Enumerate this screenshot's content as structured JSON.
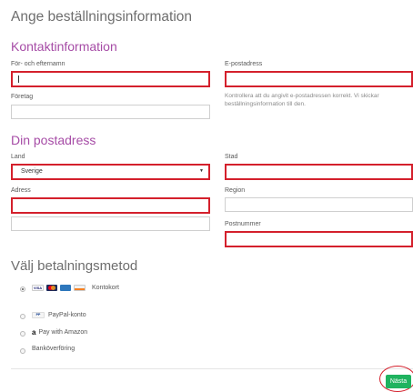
{
  "page": {
    "title": "Ange beställningsinformation"
  },
  "contact": {
    "heading": "Kontaktinformation",
    "name_label": "För- och efternamn",
    "name_value": "",
    "company_label": "Företag",
    "company_value": "",
    "email_label": "E-postadress",
    "email_value": "",
    "email_help_1": "Kontrollera att du angivit e-postadressen korrekt. Vi skickar",
    "email_help_2": "beställningsinformation till den."
  },
  "address": {
    "heading": "Din postadress",
    "country_label": "Land",
    "country_value": "Sverige",
    "address_label": "Adress",
    "address_value": "",
    "address2_value": "",
    "city_label": "Stad",
    "city_value": "",
    "region_label": "Region",
    "region_value": "",
    "postcode_label": "Postnummer",
    "postcode_value": ""
  },
  "payment": {
    "heading": "Välj betalningsmetod",
    "options": [
      {
        "label": "Kontokort",
        "selected": true,
        "icons": [
          "visa-icon",
          "mastercard-icon",
          "amex-icon",
          "discover-icon"
        ]
      },
      {
        "label": "PayPal-konto",
        "selected": false,
        "icons": [
          "paypal-icon"
        ]
      },
      {
        "label": "Pay with Amazon",
        "selected": false,
        "icons": [
          "amazon-icon"
        ]
      },
      {
        "label": "Banköverföring",
        "selected": false,
        "icons": []
      }
    ]
  },
  "actions": {
    "next_label": "Nästa"
  },
  "colors": {
    "accent": "#a64ca6",
    "error": "#d4202c",
    "primary_button": "#1fb35f"
  }
}
